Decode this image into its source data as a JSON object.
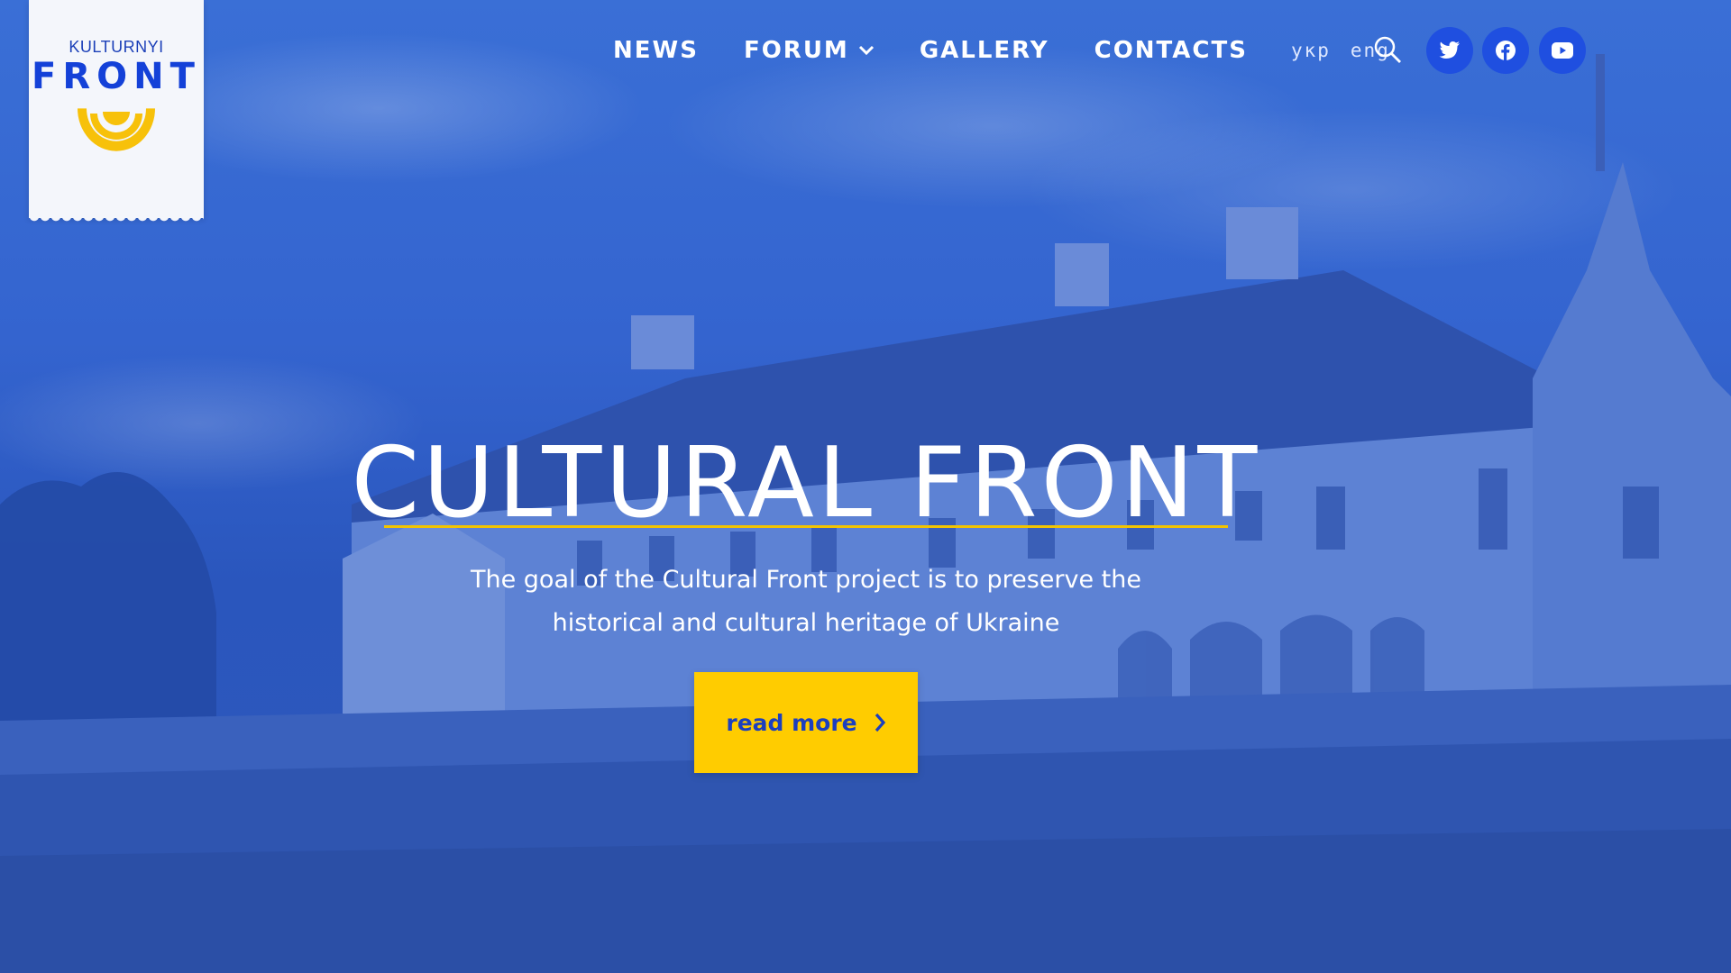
{
  "logo": {
    "top_text": "KULTURNYI",
    "main_text": "FRONT"
  },
  "nav": {
    "items": [
      {
        "label": "NEWS"
      },
      {
        "label": "FORUM",
        "has_dropdown": true
      },
      {
        "label": "GALLERY"
      },
      {
        "label": "CONTACTS"
      }
    ],
    "languages": [
      "укр",
      "eng"
    ]
  },
  "icons": {
    "search": "search-icon",
    "social": [
      "twitter-icon",
      "facebook-icon",
      "youtube-icon"
    ],
    "forum_dropdown": "chevron-down-icon",
    "cta_arrow": "chevron-right-icon"
  },
  "hero": {
    "title": "CULTURAL FRONT",
    "subtitle_line1": "The goal of the Cultural Front project is to preserve the",
    "subtitle_line2": "historical and cultural heritage of Ukraine",
    "cta_label": "read more"
  },
  "colors": {
    "brand_blue": "#1441d8",
    "accent_yellow": "#ffcc00",
    "overlay_blue": "#2f5fc9",
    "social_button": "#1f4fe0"
  }
}
